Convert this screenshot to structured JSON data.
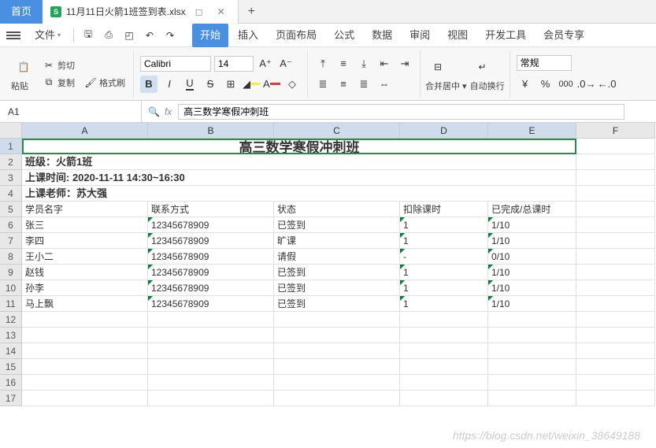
{
  "titlebar": {
    "home": "首页",
    "doc_name": "11月11日火箭1班签到表.xlsx"
  },
  "menu": {
    "file": "文件",
    "start": "开始",
    "insert": "插入",
    "page": "页面布局",
    "formula": "公式",
    "data": "数据",
    "review": "审阅",
    "view": "视图",
    "dev": "开发工具",
    "vip": "会员专享"
  },
  "toolbar": {
    "paste": "粘贴",
    "cut": "剪切",
    "copy": "复制",
    "format_paint": "格式刷",
    "font": "Calibri",
    "size": "14",
    "merge": "合并居中",
    "wrap": "自动换行",
    "numfmt": "常规"
  },
  "formula_bar": {
    "cell_ref": "A1",
    "value": "高三数学寒假冲刺班"
  },
  "columns": [
    "A",
    "B",
    "C",
    "D",
    "E",
    "F"
  ],
  "selected_row": 1,
  "sheet": {
    "title": "高三数学寒假冲刺班",
    "class_line": "班级：火箭1班",
    "time_line": "上课时间: 2020-11-11 14:30~16:30",
    "teacher_line": "上课老师：苏大强",
    "headers": [
      "学员名字",
      "联系方式",
      "状态",
      "扣除课时",
      "已完成/总课时"
    ],
    "rows": [
      {
        "name": "张三",
        "phone": "12345678909",
        "status": "已签到",
        "deduct": "1",
        "done": "1/10"
      },
      {
        "name": "李四",
        "phone": "12345678909",
        "status": "旷课",
        "deduct": "1",
        "done": "1/10"
      },
      {
        "name": "王小二",
        "phone": "12345678909",
        "status": "请假",
        "deduct": "-",
        "done": "0/10"
      },
      {
        "name": "赵钱",
        "phone": "12345678909",
        "status": "已签到",
        "deduct": "1",
        "done": "1/10"
      },
      {
        "name": "孙李",
        "phone": "12345678909",
        "status": "已签到",
        "deduct": "1",
        "done": "1/10"
      },
      {
        "name": "马上飘",
        "phone": "12345678909",
        "status": "已签到",
        "deduct": "1",
        "done": "1/10"
      }
    ]
  },
  "watermark": "https://blog.csdn.net/weixin_38649188"
}
